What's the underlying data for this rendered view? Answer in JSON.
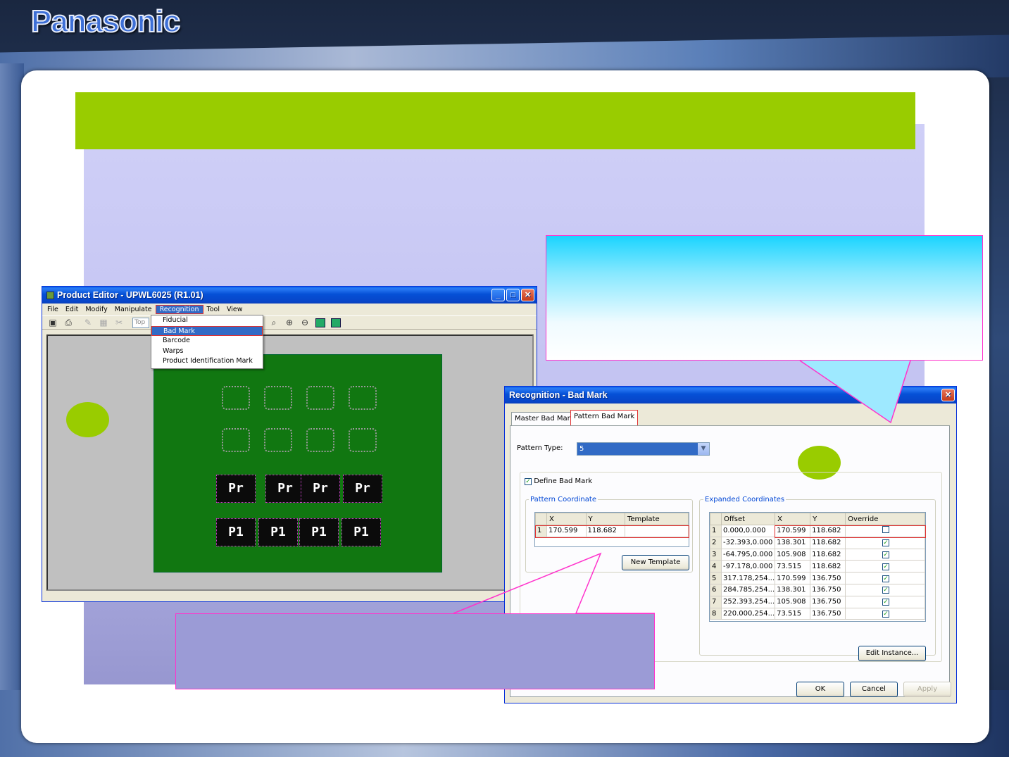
{
  "brand": {
    "logo_text": "Panasonic"
  },
  "product_editor": {
    "title": "Product Editor - UPWL6025 (R1.01)",
    "menu": [
      "File",
      "Edit",
      "Modify",
      "Manipulate",
      "Recognition",
      "Tool",
      "View"
    ],
    "toolbar_side": "Top",
    "recognition_menu": [
      "Fiducial",
      "Bad Mark",
      "Barcode",
      "Warps",
      "Product Identification Mark"
    ],
    "chip_labels": [
      "Pr",
      "P1"
    ]
  },
  "dialog": {
    "title": "Recognition - Bad Mark",
    "tabs": [
      "Master Bad Mark",
      "Pattern Bad Mark"
    ],
    "pattern_type_label": "Pattern Type:",
    "pattern_type_value": "5",
    "define_bad_mark_label": "Define Bad Mark",
    "define_bad_mark_checked": true,
    "pattern_coordinate": {
      "label": "Pattern Coordinate",
      "headers": [
        "X",
        "Y",
        "Template"
      ],
      "rows": [
        {
          "n": "1",
          "x": "170.599",
          "y": "118.682",
          "template": ""
        }
      ],
      "new_template_label": "New Template"
    },
    "expanded_coordinates": {
      "label": "Expanded Coordinates",
      "headers": [
        "Offset",
        "X",
        "Y",
        "Override"
      ],
      "rows": [
        {
          "n": "1",
          "offset": "0.000,0.000",
          "x": "170.599",
          "y": "118.682",
          "override": false
        },
        {
          "n": "2",
          "offset": "-32.393,0.000",
          "x": "138.301",
          "y": "118.682",
          "override": true
        },
        {
          "n": "3",
          "offset": "-64.795,0.000",
          "x": "105.908",
          "y": "118.682",
          "override": true
        },
        {
          "n": "4",
          "offset": "-97.178,0.000",
          "x": "73.515",
          "y": "118.682",
          "override": true
        },
        {
          "n": "5",
          "offset": "317.178,254...",
          "x": "170.599",
          "y": "136.750",
          "override": true
        },
        {
          "n": "6",
          "offset": "284.785,254...",
          "x": "138.301",
          "y": "136.750",
          "override": true
        },
        {
          "n": "7",
          "offset": "252.393,254...",
          "x": "105.908",
          "y": "136.750",
          "override": true
        },
        {
          "n": "8",
          "offset": "220.000,254...",
          "x": "73.515",
          "y": "136.750",
          "override": true
        }
      ],
      "edit_instance_label": "Edit Instance..."
    },
    "buttons": {
      "ok": "OK",
      "cancel": "Cancel",
      "apply": "Apply"
    }
  },
  "colors": {
    "accent_green": "#99cc00",
    "callout_border": "#ff33cc",
    "xp_blue": "#0a5fe8"
  }
}
